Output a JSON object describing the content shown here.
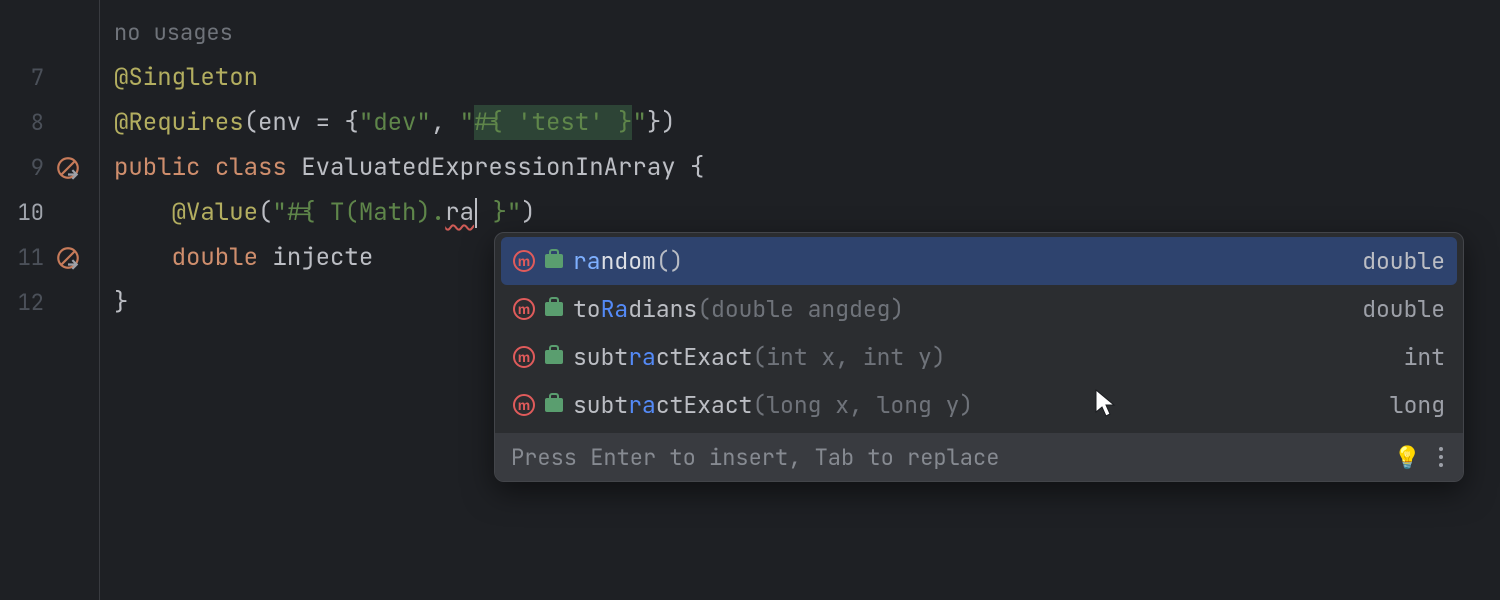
{
  "gutter": {
    "hint_line": "",
    "lines": [
      "7",
      "8",
      "9",
      "10",
      "11",
      "12"
    ],
    "current": "10"
  },
  "code": {
    "usages_hint": "no usages",
    "l7_anno": "@Singleton",
    "l8_anno": "@Requires",
    "l8_paren_open": "(env = {",
    "l8_str1": "\"dev\"",
    "l8_sep": ", ",
    "l8_str2a": "\"",
    "l8_str2b": "#{ 'test' }",
    "l8_str2c": "\"",
    "l8_paren_close": "})",
    "l9_kw1": "public",
    "l9_kw2": "class",
    "l9_cls": "EvaluatedExpressionInArray",
    "l9_brace": " {",
    "l10_anno": "@Value",
    "l10_open": "(",
    "l10_str_a": "\"#{ T(Math).",
    "l10_err": "ra",
    "l10_str_b": " }\"",
    "l10_close": ")",
    "l11_kw": "double",
    "l11_name": " injecte",
    "l12_brace": "}"
  },
  "popup": {
    "items": [
      {
        "pre": "ra",
        "mid": "ndom",
        "params": "()",
        "ret": "double"
      },
      {
        "pre": "to",
        "m1": "Ra",
        "mid": "dians",
        "params": "(double angdeg)",
        "ret": "double"
      },
      {
        "pre": "subt",
        "m1": "ra",
        "mid": "ctExact",
        "params": "(int x, int y)",
        "ret": "int"
      },
      {
        "pre": "subt",
        "m1": "ra",
        "mid": "ctExact",
        "params": "(long x, long y)",
        "ret": "long"
      }
    ],
    "footer": "Press Enter to insert, Tab to replace"
  },
  "icons": {
    "method": "m"
  }
}
